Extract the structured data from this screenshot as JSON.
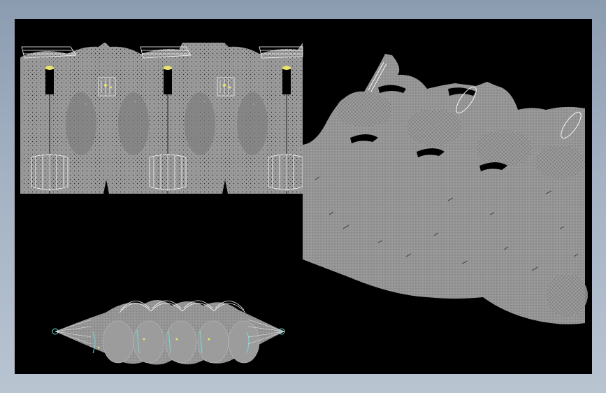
{
  "app": {
    "background_color": "#97a6b8",
    "viewport_color": "#000000",
    "mesh_color": "#9a9a9a",
    "mesh_dark_color": "#7e7e7e",
    "line_color": "#ffffff",
    "accent_yellow": "#e8e56a",
    "accent_cyan": "#6ee0d8"
  },
  "views": [
    {
      "name": "front-elevation-view"
    },
    {
      "name": "perspective-view"
    },
    {
      "name": "plan-view"
    }
  ]
}
